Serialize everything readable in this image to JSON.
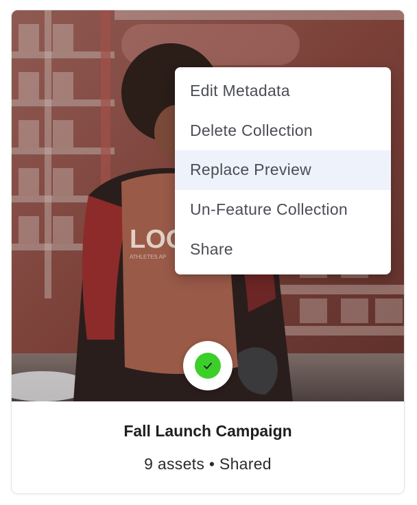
{
  "card": {
    "preview_image": "collection-preview-photo",
    "status_icon": "checkmark-icon",
    "status_color": "#3ccf2a",
    "title": "Fall Launch Campaign",
    "asset_count": "9 assets",
    "separator": "•",
    "sharing": "Shared"
  },
  "menu": {
    "items": [
      {
        "label": "Edit Metadata"
      },
      {
        "label": "Delete Collection"
      },
      {
        "label": "Replace Preview"
      },
      {
        "label": "Un-Feature Collection"
      },
      {
        "label": "Share"
      }
    ],
    "highlighted_item": "Replace Preview",
    "highlight_color": "#eef2fb"
  }
}
